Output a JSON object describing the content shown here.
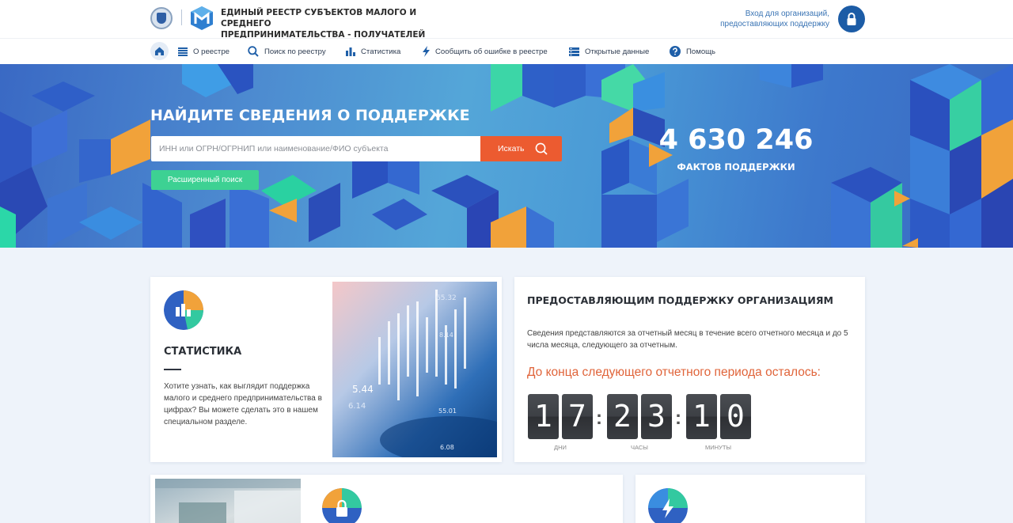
{
  "header": {
    "title_line1": "ЕДИНЫЙ РЕЕСТР СУБЪЕКТОВ МАЛОГО И СРЕДНЕГО",
    "title_line2": "ПРЕДПРИНИМАТЕЛЬСТВА - ПОЛУЧАТЕЛЕЙ ПОДДЕРЖКИ",
    "login_line1": "Вход для организаций,",
    "login_line2": "предоставляющих поддержку"
  },
  "nav": {
    "items": [
      {
        "label": "О реестре",
        "icon": "list-icon"
      },
      {
        "label": "Поиск по реестру",
        "icon": "search-icon"
      },
      {
        "label": "Статистика",
        "icon": "bar-chart-icon"
      },
      {
        "label": "Сообщить об ошибке в реестре",
        "icon": "lightning-icon"
      },
      {
        "label": "Открытые данные",
        "icon": "database-icon"
      },
      {
        "label": "Помощь",
        "icon": "help-icon"
      }
    ]
  },
  "hero": {
    "title": "НАЙДИТЕ СВЕДЕНИЯ О ПОДДЕРЖКЕ",
    "search_placeholder": "ИНН или ОГРН/ОГРНИП или наименование/ФИО субъекта",
    "search_button": "Искать",
    "advanced_button": "Расширенный поиск",
    "counter": "4 630 246",
    "counter_label": "ФАКТОВ ПОДДЕРЖКИ"
  },
  "stats_card": {
    "title": "СТАТИСТИКА",
    "text": "Хотите узнать, как выглядит поддержка малого и среднего предпринимательства в цифрах? Вы можете сделать это в нашем специальном разделе.",
    "photo_numbers": [
      "65.32",
      "8.14",
      "5.44",
      "6.14",
      "55.01",
      "6.08"
    ]
  },
  "org_card": {
    "title": "ПРЕДОСТАВЛЯЮЩИМ ПОДДЕРЖКУ ОРГАНИЗАЦИЯМ",
    "text": "Сведения представляются за отчетный месяц в течение всего отчетного месяца и до 5 числа месяца, следующего за отчетным.",
    "deadline": "До конца следующего отчетного периода осталось:",
    "countdown": {
      "days": [
        "1",
        "7"
      ],
      "hours": [
        "2",
        "3"
      ],
      "minutes": [
        "1",
        "0"
      ],
      "labels": {
        "days": "ДНИ",
        "hours": "ЧАСЫ",
        "minutes": "МИНУТЫ"
      }
    }
  },
  "colors": {
    "accent_orange": "#ec5b30",
    "accent_green": "#3dd193",
    "brand_blue": "#1c5ca6"
  }
}
